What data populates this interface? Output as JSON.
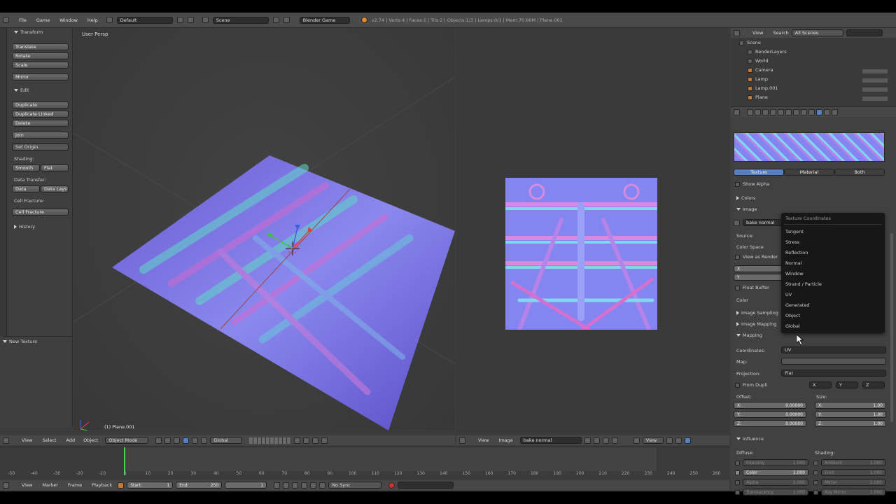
{
  "top_bar": {
    "menus": [
      "File",
      "Game",
      "Window",
      "Help"
    ],
    "layout": "Default",
    "scene": "Scene",
    "engine": "Blender Game",
    "stats": "v2.74 | Verts:4 | Faces:1 | Tris:2 | Objects:1/3 | Lamps:0/1 | Mem:70.80M | Plane.001"
  },
  "toolshelf": {
    "transform_header": "Transform",
    "transform_buttons": [
      "Translate",
      "Rotate",
      "Scale"
    ],
    "mirror": "Mirror",
    "edit_header": "Edit",
    "edit_buttons": [
      "Duplicate",
      "Duplicate Linked",
      "Delete"
    ],
    "join": "Join",
    "set_origin": "Set Origin",
    "shading_label": "Shading:",
    "smooth": "Smooth",
    "flat": "Flat",
    "data_transfer_label": "Data Transfer:",
    "data": "Data",
    "data_layers": "Data Lays",
    "cell_fracture_label": "Cell Fracture:",
    "cell_fracture": "Cell Fracture",
    "history": "History",
    "new_texture": "New Texture"
  },
  "viewport": {
    "label": "User Persp",
    "object_label": "(1) Plane.001",
    "header_menus": [
      "View",
      "Select",
      "Add",
      "Object"
    ],
    "mode": "Object Mode",
    "orientation": "Global"
  },
  "image_editor": {
    "menus": [
      "View",
      "Image"
    ],
    "image_name": "bake normal",
    "view": "View"
  },
  "outliner": {
    "menus": [
      "View",
      "Search"
    ],
    "filter": "All Scenes",
    "items": [
      "Scene",
      "RenderLayers",
      "World",
      "Camera",
      "Lamp",
      "Lamp.001",
      "Plane"
    ]
  },
  "properties": {
    "preview_tabs": [
      "Texture",
      "Material",
      "Both"
    ],
    "show_alpha": "Show Alpha",
    "colors": "Colors",
    "image": "Image",
    "texture_name": "bake normal",
    "source": "Source:",
    "color_space": "Color Space",
    "view_as_render": "View as Render",
    "fields": [
      "X",
      "Y"
    ],
    "float_buffer": "Float Buffer",
    "color": "Color",
    "image_sampling": "Image Sampling",
    "image_mapping": "Image Mapping",
    "mapping": "Mapping",
    "coordinates_label": "Coordinates:",
    "coordinates_value": "UV",
    "map_label": "Map:",
    "projection_label": "Projection:",
    "projection_value": "Flat",
    "from_dupli": "From Dupli",
    "dupli_axes": [
      "X",
      "Y",
      "Z"
    ],
    "offset_label": "Offset:",
    "size_label": "Size:",
    "offset": [
      {
        "axis": "X:",
        "value": "0.00000"
      },
      {
        "axis": "Y:",
        "value": "0.00000"
      },
      {
        "axis": "Z:",
        "value": "0.00000"
      }
    ],
    "size": [
      {
        "axis": "X:",
        "value": "1.00"
      },
      {
        "axis": "Y:",
        "value": "1.00"
      },
      {
        "axis": "Z:",
        "value": "1.00"
      }
    ],
    "influence": "Influence",
    "diffuse_label": "Diffuse:",
    "shading_label": "Shading:",
    "diffuse_items": [
      {
        "label": "Intensity",
        "value": "1.000"
      },
      {
        "label": "Color",
        "value": "1.000"
      },
      {
        "label": "Alpha",
        "value": "1.000"
      },
      {
        "label": "Translucency",
        "value": "1.000"
      }
    ],
    "shading_items": [
      {
        "label": "Ambient",
        "value": "1.000"
      },
      {
        "label": "Emit",
        "value": "1.000"
      },
      {
        "label": "Mirror",
        "value": "1.000"
      },
      {
        "label": "Ray Mirror",
        "value": "1.000"
      }
    ]
  },
  "dropdown": {
    "title": "Texture Coordinates",
    "options": [
      "Tangent",
      "Stress",
      "Reflection",
      "Normal",
      "Window",
      "Strand / Particle",
      "UV",
      "Generated",
      "Object",
      "Global"
    ]
  },
  "timeline": {
    "menus": [
      "View",
      "Marker",
      "Frame",
      "Playback"
    ],
    "start": "Start:",
    "start_value": "1",
    "end": "End:",
    "end_value": "250",
    "current": "1",
    "sync": "No Sync",
    "ruler": [
      "-50",
      "-40",
      "-30",
      "-20",
      "-10",
      "0",
      "10",
      "20",
      "30",
      "40",
      "50",
      "60",
      "70",
      "80",
      "90",
      "100",
      "110",
      "120",
      "130",
      "140",
      "150",
      "160",
      "170",
      "180",
      "190",
      "200",
      "210",
      "220",
      "230",
      "240",
      "250",
      "260"
    ]
  },
  "colors": {
    "accent": "#5680c2",
    "timeline_cursor": "#4fd04f"
  }
}
